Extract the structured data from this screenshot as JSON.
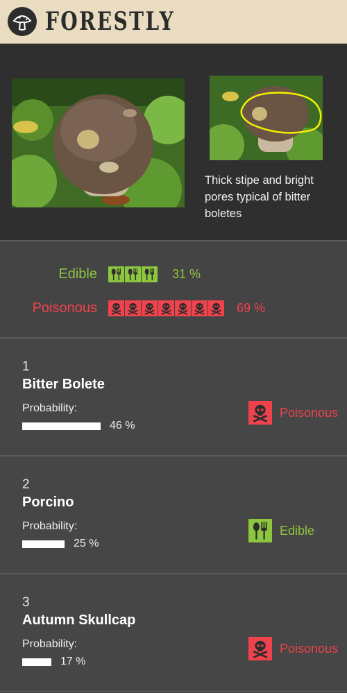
{
  "header": {
    "brand": "FORESTLY",
    "logo_icon": "mushroom-icon"
  },
  "hero": {
    "caption": "Thick stipe and bright pores typical of bitter boletes"
  },
  "summary": {
    "edible": {
      "label": "Edible",
      "percent_text": "31 %",
      "value": 31,
      "icon_count": 3,
      "icon": "fork-spoon-icon",
      "color": "#8dc63f"
    },
    "poisonous": {
      "label": "Poisonous",
      "percent_text": "69 %",
      "value": 69,
      "icon_count": 7,
      "icon": "skull-crossbones-icon",
      "color": "#f0424c"
    }
  },
  "results": [
    {
      "rank": "1",
      "name": "Bitter Bolete",
      "prob_label": "Probability:",
      "prob_text": "46 %",
      "prob": 0.46,
      "status": "Poisonous",
      "status_icon": "skull-crossbones-icon"
    },
    {
      "rank": "2",
      "name": "Porcino",
      "prob_label": "Probability:",
      "prob_text": "25 %",
      "prob": 0.25,
      "status": "Edible",
      "status_icon": "fork-spoon-icon"
    },
    {
      "rank": "3",
      "name": "Autumn Skullcap",
      "prob_label": "Probability:",
      "prob_text": "17 %",
      "prob": 0.17,
      "status": "Poisonous",
      "status_icon": "skull-crossbones-icon"
    }
  ]
}
